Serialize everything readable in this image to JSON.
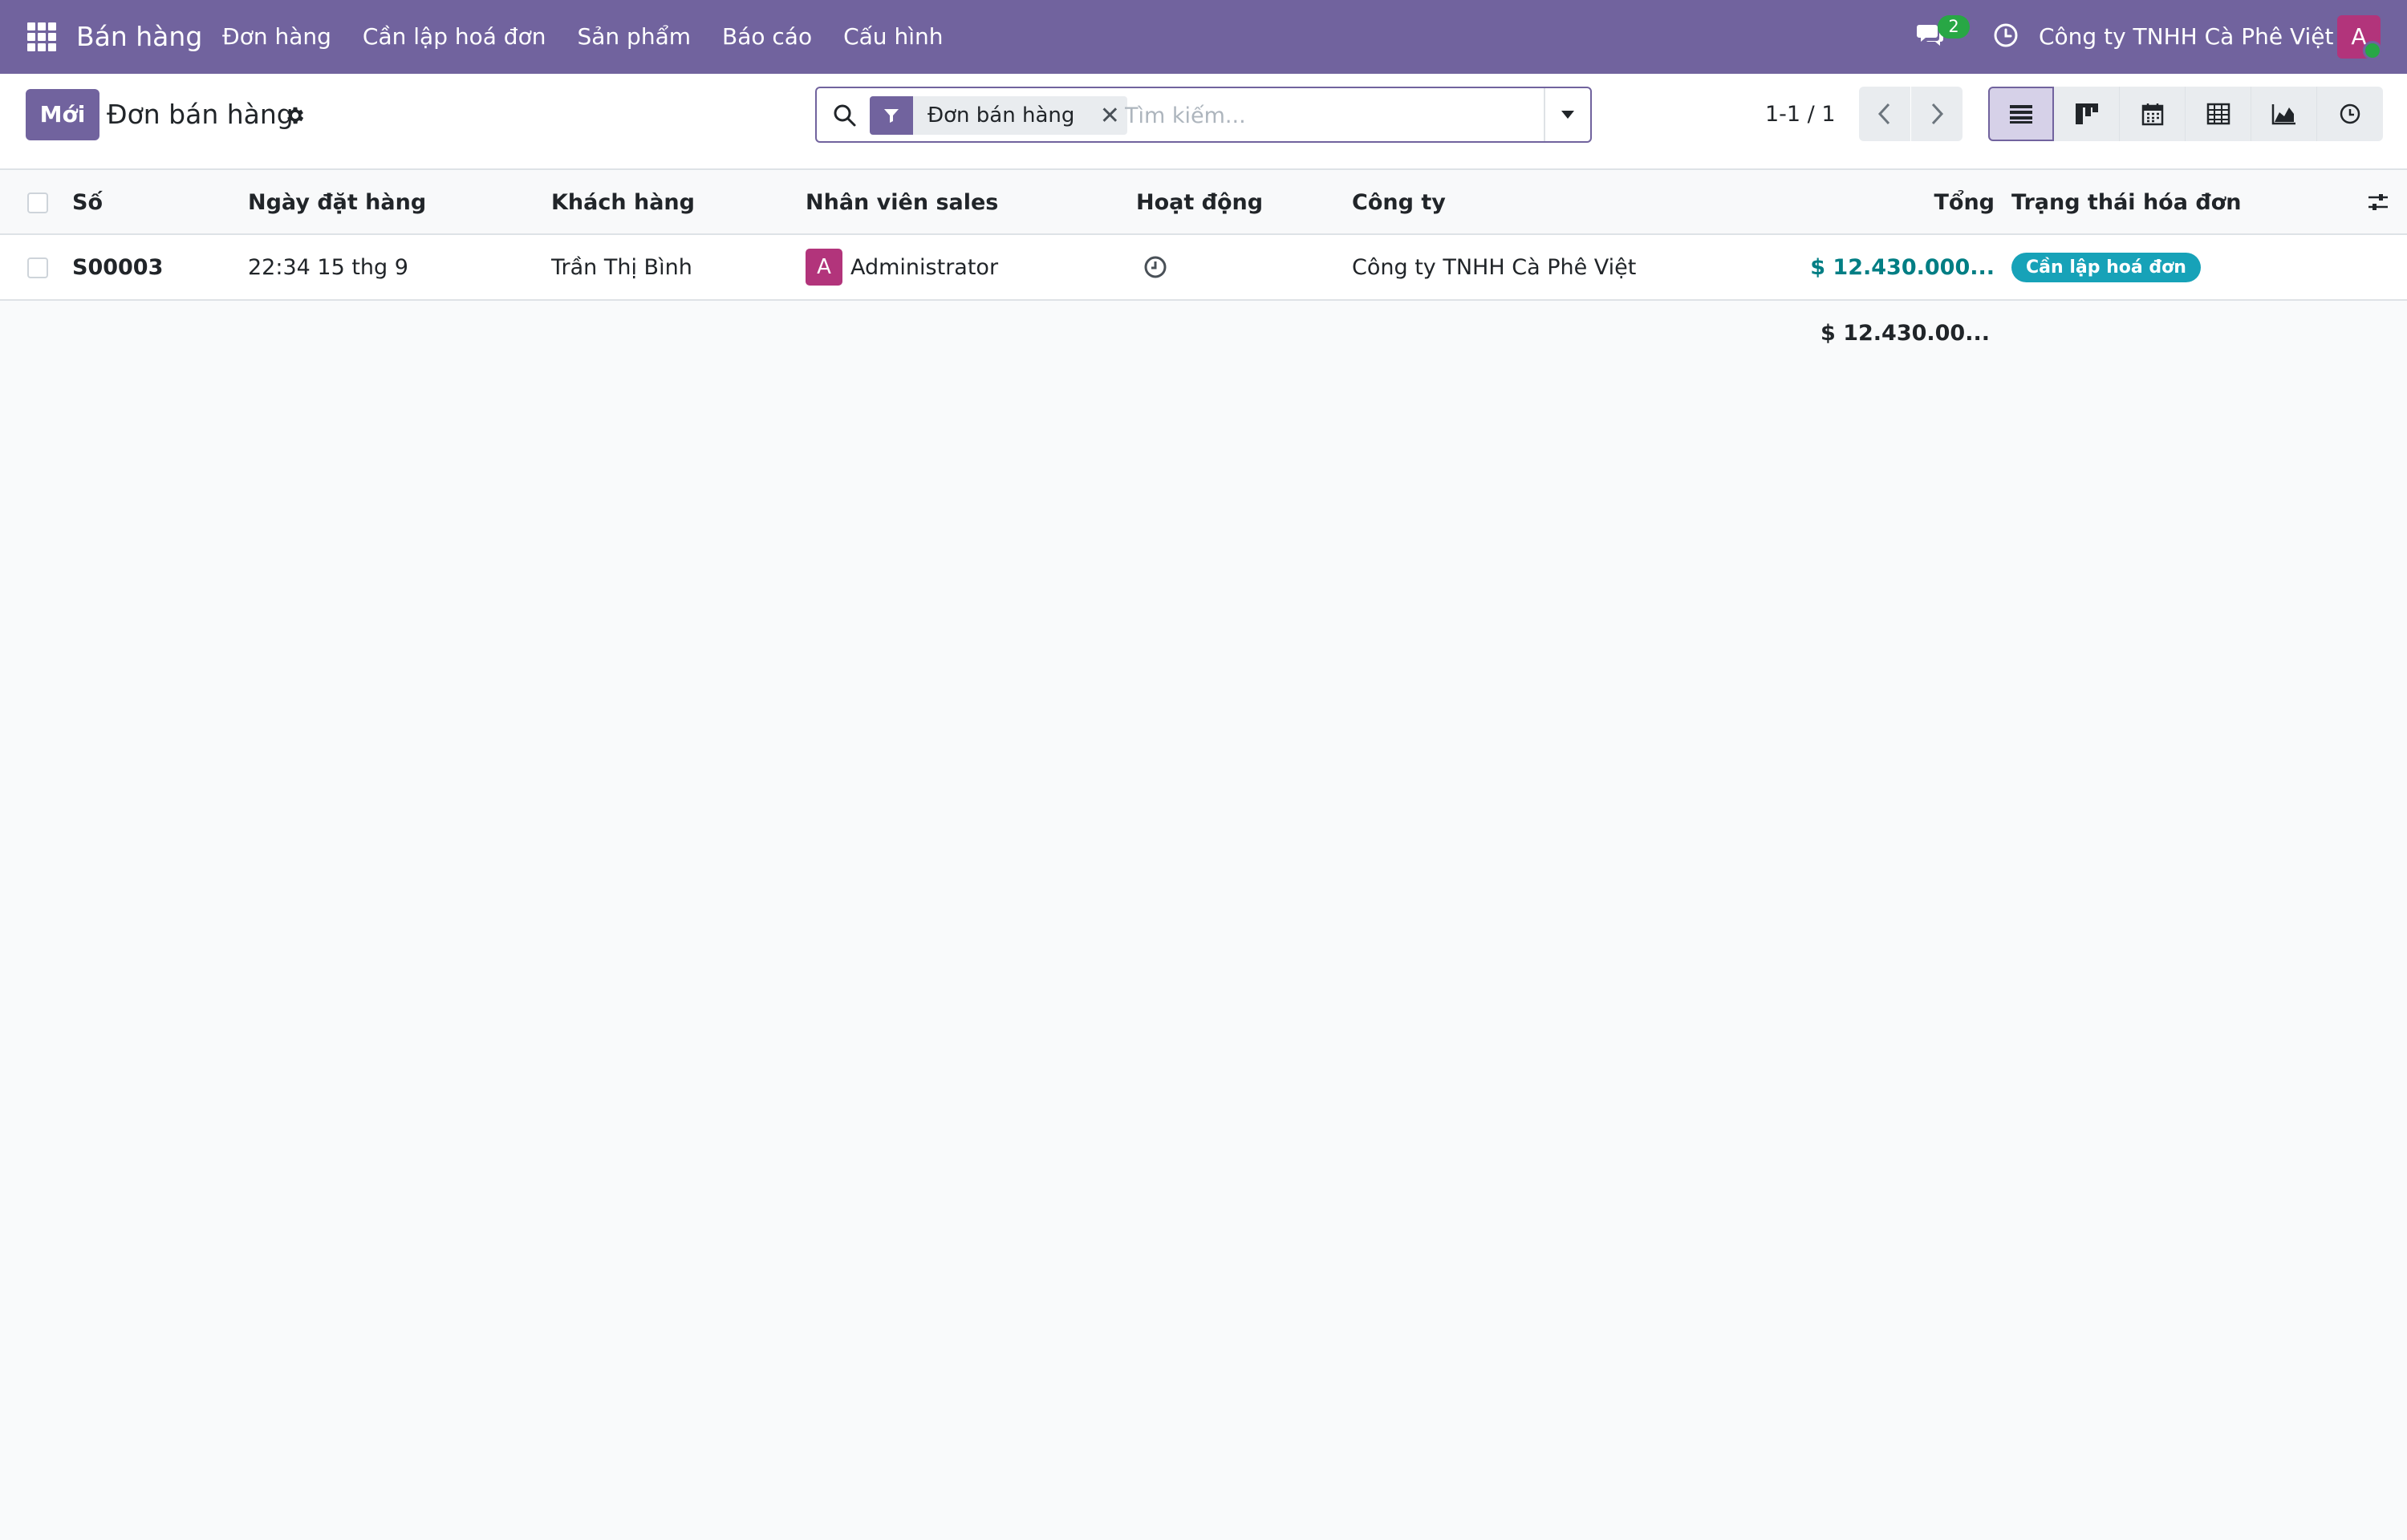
{
  "navbar": {
    "brand": "Bán hàng",
    "menu": [
      "Đơn hàng",
      "Cần lập hoá đơn",
      "Sản phẩm",
      "Báo cáo",
      "Cấu hình"
    ],
    "chat_count": "2",
    "company": "Công ty TNHH Cà Phê Việt",
    "user_initial": "A",
    "icons": {
      "apps": "apps-grid-icon",
      "chat": "chat-icon",
      "activity": "clock-icon"
    },
    "colors": {
      "navbar_bg": "#71639e",
      "avatar_bg": "#b2347b",
      "online": "#28a745"
    }
  },
  "control_panel": {
    "new_label": "Mới",
    "title": "Đơn bán hàng",
    "search": {
      "facet_label": "Đơn bán hàng",
      "placeholder": "Tìm kiếm...",
      "value": ""
    },
    "pager": "1-1 / 1",
    "views": [
      "list",
      "kanban",
      "calendar",
      "pivot",
      "graph",
      "activity"
    ],
    "active_view": "list"
  },
  "table": {
    "columns": [
      "Số",
      "Ngày đặt hàng",
      "Khách hàng",
      "Nhân viên sales",
      "Hoạt động",
      "Công ty",
      "Tổng",
      "Trạng thái hóa đơn"
    ],
    "rows": [
      {
        "number": "S00003",
        "order_date": "22:34 15 thg 9",
        "customer": "Trần Thị Bình",
        "salesperson_initial": "A",
        "salesperson": "Administrator",
        "company": "Công ty TNHH Cà Phê Việt",
        "total": "$ 12.430.000...",
        "invoice_status": "Cần lập hoá đơn"
      }
    ],
    "footer_total": "$ 12.430.00..."
  }
}
